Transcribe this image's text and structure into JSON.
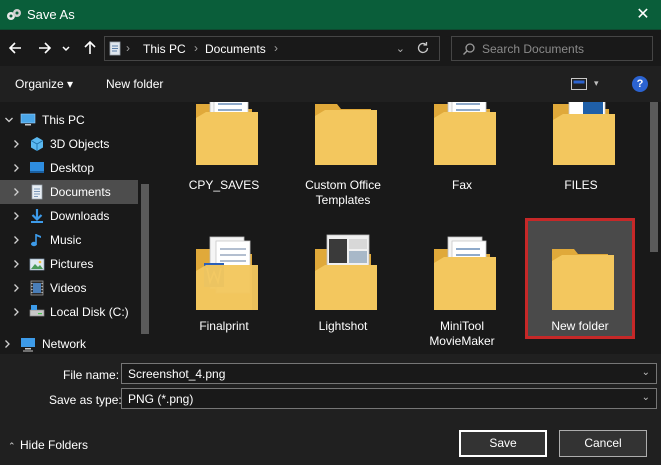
{
  "window": {
    "title": "Save As",
    "close_glyph": "✕"
  },
  "address": {
    "crumbs": [
      "This PC",
      "Documents"
    ],
    "separator_glyph": "›",
    "dropdown_glyph": "⌄",
    "search_placeholder": "Search Documents"
  },
  "toolbar": {
    "organize_label": "Organize ▾",
    "new_folder_label": "New folder",
    "help_label": "?",
    "view_dropdown_glyph": "▾"
  },
  "sidebar": {
    "items": [
      {
        "label": "This PC",
        "icon": "monitor-icon",
        "expanded": true
      },
      {
        "label": "3D Objects",
        "icon": "cube-icon"
      },
      {
        "label": "Desktop",
        "icon": "desktop-icon"
      },
      {
        "label": "Documents",
        "icon": "document-icon",
        "selected": true
      },
      {
        "label": "Downloads",
        "icon": "download-icon"
      },
      {
        "label": "Music",
        "icon": "music-icon"
      },
      {
        "label": "Pictures",
        "icon": "pictures-icon"
      },
      {
        "label": "Videos",
        "icon": "video-icon"
      },
      {
        "label": "Local Disk (C:)",
        "icon": "disk-icon"
      },
      {
        "label": "Network",
        "icon": "network-icon"
      }
    ]
  },
  "files": [
    {
      "label": "CPY_SAVES",
      "thumb": "folder-docs"
    },
    {
      "label": "Custom Office Templates",
      "thumb": "folder-plain"
    },
    {
      "label": "Fax",
      "thumb": "folder-docs"
    },
    {
      "label": "FILES",
      "thumb": "folder-excel"
    },
    {
      "label": "Finalprint",
      "thumb": "folder-word"
    },
    {
      "label": "Lightshot",
      "thumb": "folder-screens"
    },
    {
      "label": "MiniTool MovieMaker",
      "thumb": "folder-docs"
    },
    {
      "label": "New folder",
      "thumb": "folder-plain",
      "highlighted": true
    }
  ],
  "form": {
    "file_name_label": "File name:",
    "file_name_value": "Screenshot_4.png",
    "type_label": "Save as type:",
    "type_value": "PNG (*.png)",
    "dropdown_glyph": "⌄"
  },
  "footer": {
    "hide_folders_label": "Hide Folders",
    "hide_folders_glyph": "⌃",
    "save_label": "Save",
    "cancel_label": "Cancel"
  },
  "colors": {
    "titlebar": "#0a5e3a",
    "folder": "#f3c75e",
    "highlight": "#c62828"
  }
}
